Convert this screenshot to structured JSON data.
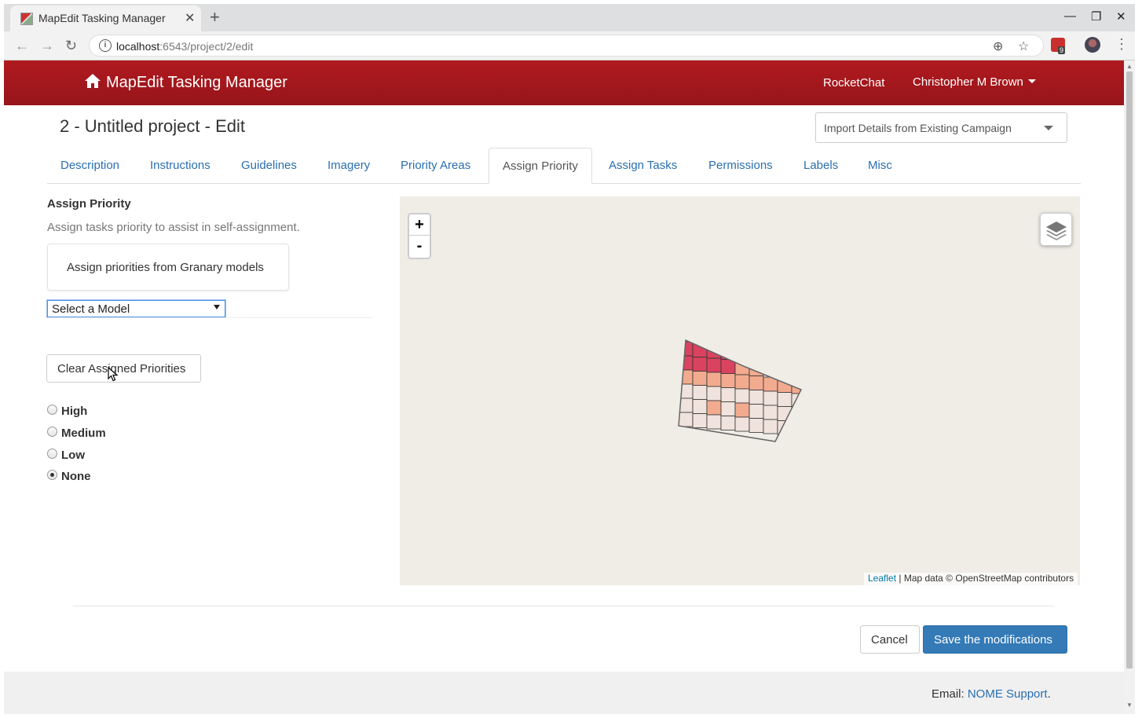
{
  "browser": {
    "tab_title": "MapEdit Tasking Manager",
    "url_host": "localhost",
    "url_rest": ":6543/project/2/edit",
    "extension_badge": "9"
  },
  "navbar": {
    "brand": "MapEdit Tasking Manager",
    "rocketchat": "RocketChat",
    "user": "Christopher M Brown"
  },
  "project": {
    "title": "2 - Untitled project - Edit",
    "import_placeholder": "Import Details from Existing Campaign"
  },
  "tabs": [
    {
      "label": "Description"
    },
    {
      "label": "Instructions"
    },
    {
      "label": "Guidelines"
    },
    {
      "label": "Imagery"
    },
    {
      "label": "Priority Areas"
    },
    {
      "label": "Assign Priority"
    },
    {
      "label": "Assign Tasks"
    },
    {
      "label": "Permissions"
    },
    {
      "label": "Labels"
    },
    {
      "label": "Misc"
    }
  ],
  "assign": {
    "heading": "Assign Priority",
    "description": "Assign tasks priority to assist in self-assignment.",
    "granary_label": "Assign priorities from Granary models",
    "model_select": "Select a Model",
    "clear_button": "Clear Assigned Priorities",
    "priorities": [
      {
        "label": "High",
        "checked": false
      },
      {
        "label": "Medium",
        "checked": false
      },
      {
        "label": "Low",
        "checked": false
      },
      {
        "label": "None",
        "checked": true
      }
    ]
  },
  "map": {
    "zoom_in": "+",
    "zoom_out": "-",
    "attribution_link": "Leaflet",
    "attribution_text": " | Map data © OpenStreetMap contributors",
    "colors": {
      "high": "#d9435f",
      "medium": "#f2ab8f",
      "low": "#f0e2dc",
      "none": "#f4f2ef"
    }
  },
  "actions": {
    "cancel": "Cancel",
    "save": "Save the modifications"
  },
  "footer": {
    "prefix": "Email: ",
    "link": "NOME Support",
    "suffix": "."
  }
}
